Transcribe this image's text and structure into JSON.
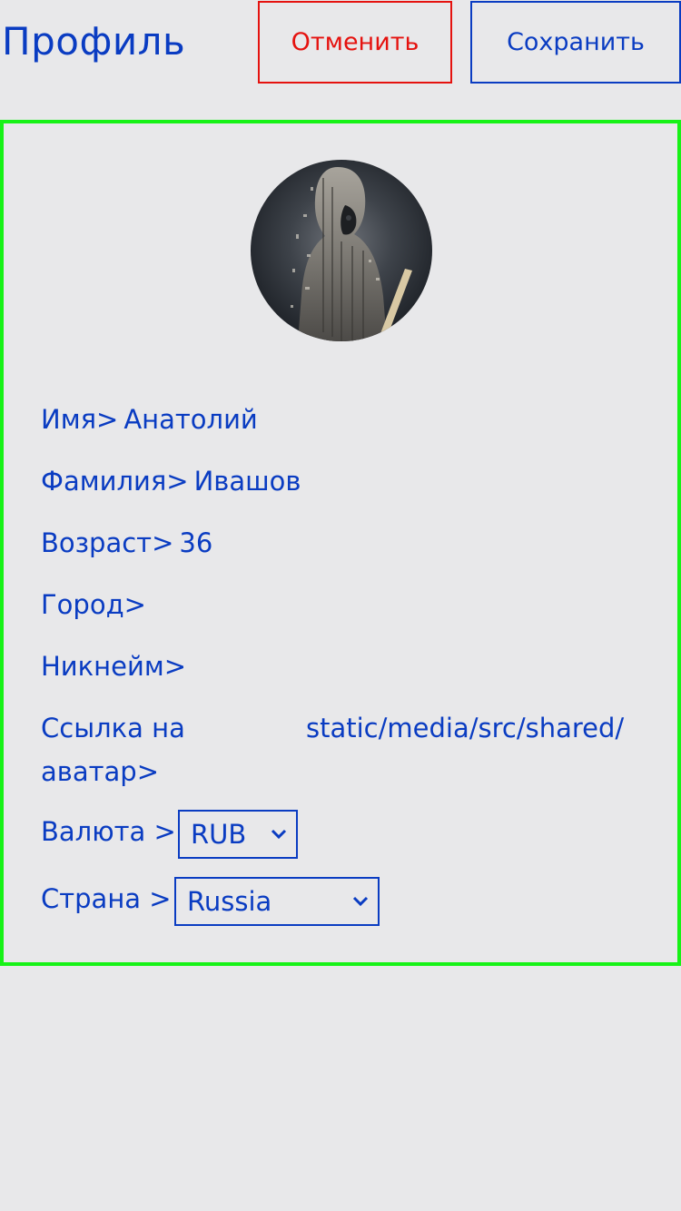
{
  "header": {
    "title": "Профиль",
    "cancel_label": "Отменить",
    "save_label": "Сохранить"
  },
  "profile": {
    "avatar_icon": "avatar-image",
    "fields": [
      {
        "label": "Имя>",
        "value": "Анатолий"
      },
      {
        "label": "Фамилия>",
        "value": "Ивашов"
      },
      {
        "label": "Возраст>",
        "value": "36"
      },
      {
        "label": "Город>",
        "value": ""
      },
      {
        "label": "Никнейм>",
        "value": ""
      }
    ],
    "avatar_link": {
      "label": "Ссылка на аватар>",
      "value": "static/media/src/shared/"
    },
    "currency": {
      "label": "Валюта >",
      "selected": "RUB"
    },
    "country": {
      "label": "Страна >",
      "selected": "Russia"
    }
  },
  "colors": {
    "accent": "#0a3cc2",
    "cancel": "#e5120f",
    "card_border": "#17f217",
    "background": "#e8e8ea"
  }
}
